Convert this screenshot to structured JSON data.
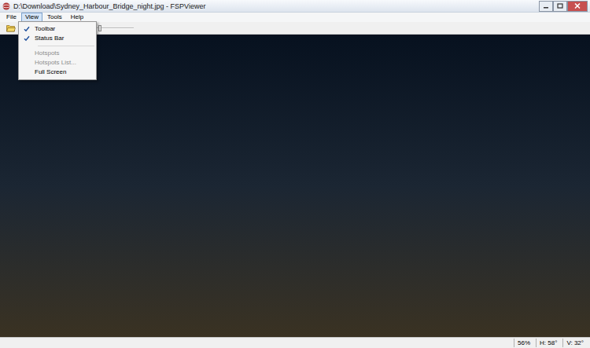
{
  "window": {
    "title": "D:\\Download\\Sydney_Harbour_Bridge_night.jpg - FSPViewer"
  },
  "menu_bar": [
    {
      "label": "File",
      "selected": false
    },
    {
      "label": "View",
      "selected": true
    },
    {
      "label": "Tools",
      "selected": false
    },
    {
      "label": "Help",
      "selected": false
    }
  ],
  "view_menu": {
    "items": [
      {
        "kind": "check",
        "label": "Toolbar",
        "checked": true,
        "disabled": false
      },
      {
        "kind": "check",
        "label": "Status Bar",
        "checked": true,
        "disabled": false
      },
      {
        "kind": "separator"
      },
      {
        "kind": "item",
        "label": "Hotspots",
        "checked": false,
        "disabled": true
      },
      {
        "kind": "item",
        "label": "Hotspots List...",
        "checked": false,
        "disabled": true
      },
      {
        "kind": "item",
        "label": "Full Screen",
        "checked": false,
        "disabled": false
      }
    ]
  },
  "toolbar": {
    "zoom_slider": {
      "level": 0.65
    }
  },
  "status_bar": {
    "zoom": "56%",
    "h": "H: 58°",
    "v": "V: 32°"
  }
}
